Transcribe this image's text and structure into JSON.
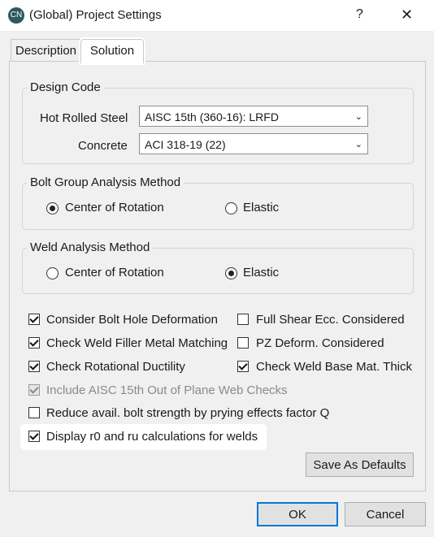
{
  "window": {
    "title": "(Global) Project Settings",
    "icon": "CN",
    "help": "?",
    "close": "✕"
  },
  "tabs": [
    {
      "label": "Description"
    },
    {
      "label": "Solution"
    }
  ],
  "design_code": {
    "title": "Design Code",
    "hot_rolled_label": "Hot Rolled Steel",
    "hot_rolled_value": "AISC 15th (360-16): LRFD",
    "concrete_label": "Concrete",
    "concrete_value": "ACI 318-19 (22)"
  },
  "bolt_group": {
    "title": "Bolt Group Analysis Method",
    "opt1": "Center of Rotation",
    "opt2": "Elastic",
    "selected": "Center of Rotation"
  },
  "weld": {
    "title": "Weld Analysis Method",
    "opt1": "Center of Rotation",
    "opt2": "Elastic",
    "selected": "Elastic"
  },
  "checks": {
    "c1": "Consider Bolt Hole Deformation",
    "c2": "Full Shear Ecc. Considered",
    "c3": "Check Weld Filler Metal Matching",
    "c4": "PZ Deform. Considered",
    "c5": "Check Rotational Ductility",
    "c6": "Check Weld Base Mat. Thick",
    "c7": "Include AISC 15th Out of Plane Web Checks",
    "c8": "Reduce avail. bolt strength by prying effects factor Q",
    "c9": "Display r0 and ru calculations for welds"
  },
  "buttons": {
    "save_defaults": "Save As Defaults",
    "ok": "OK",
    "cancel": "Cancel"
  }
}
